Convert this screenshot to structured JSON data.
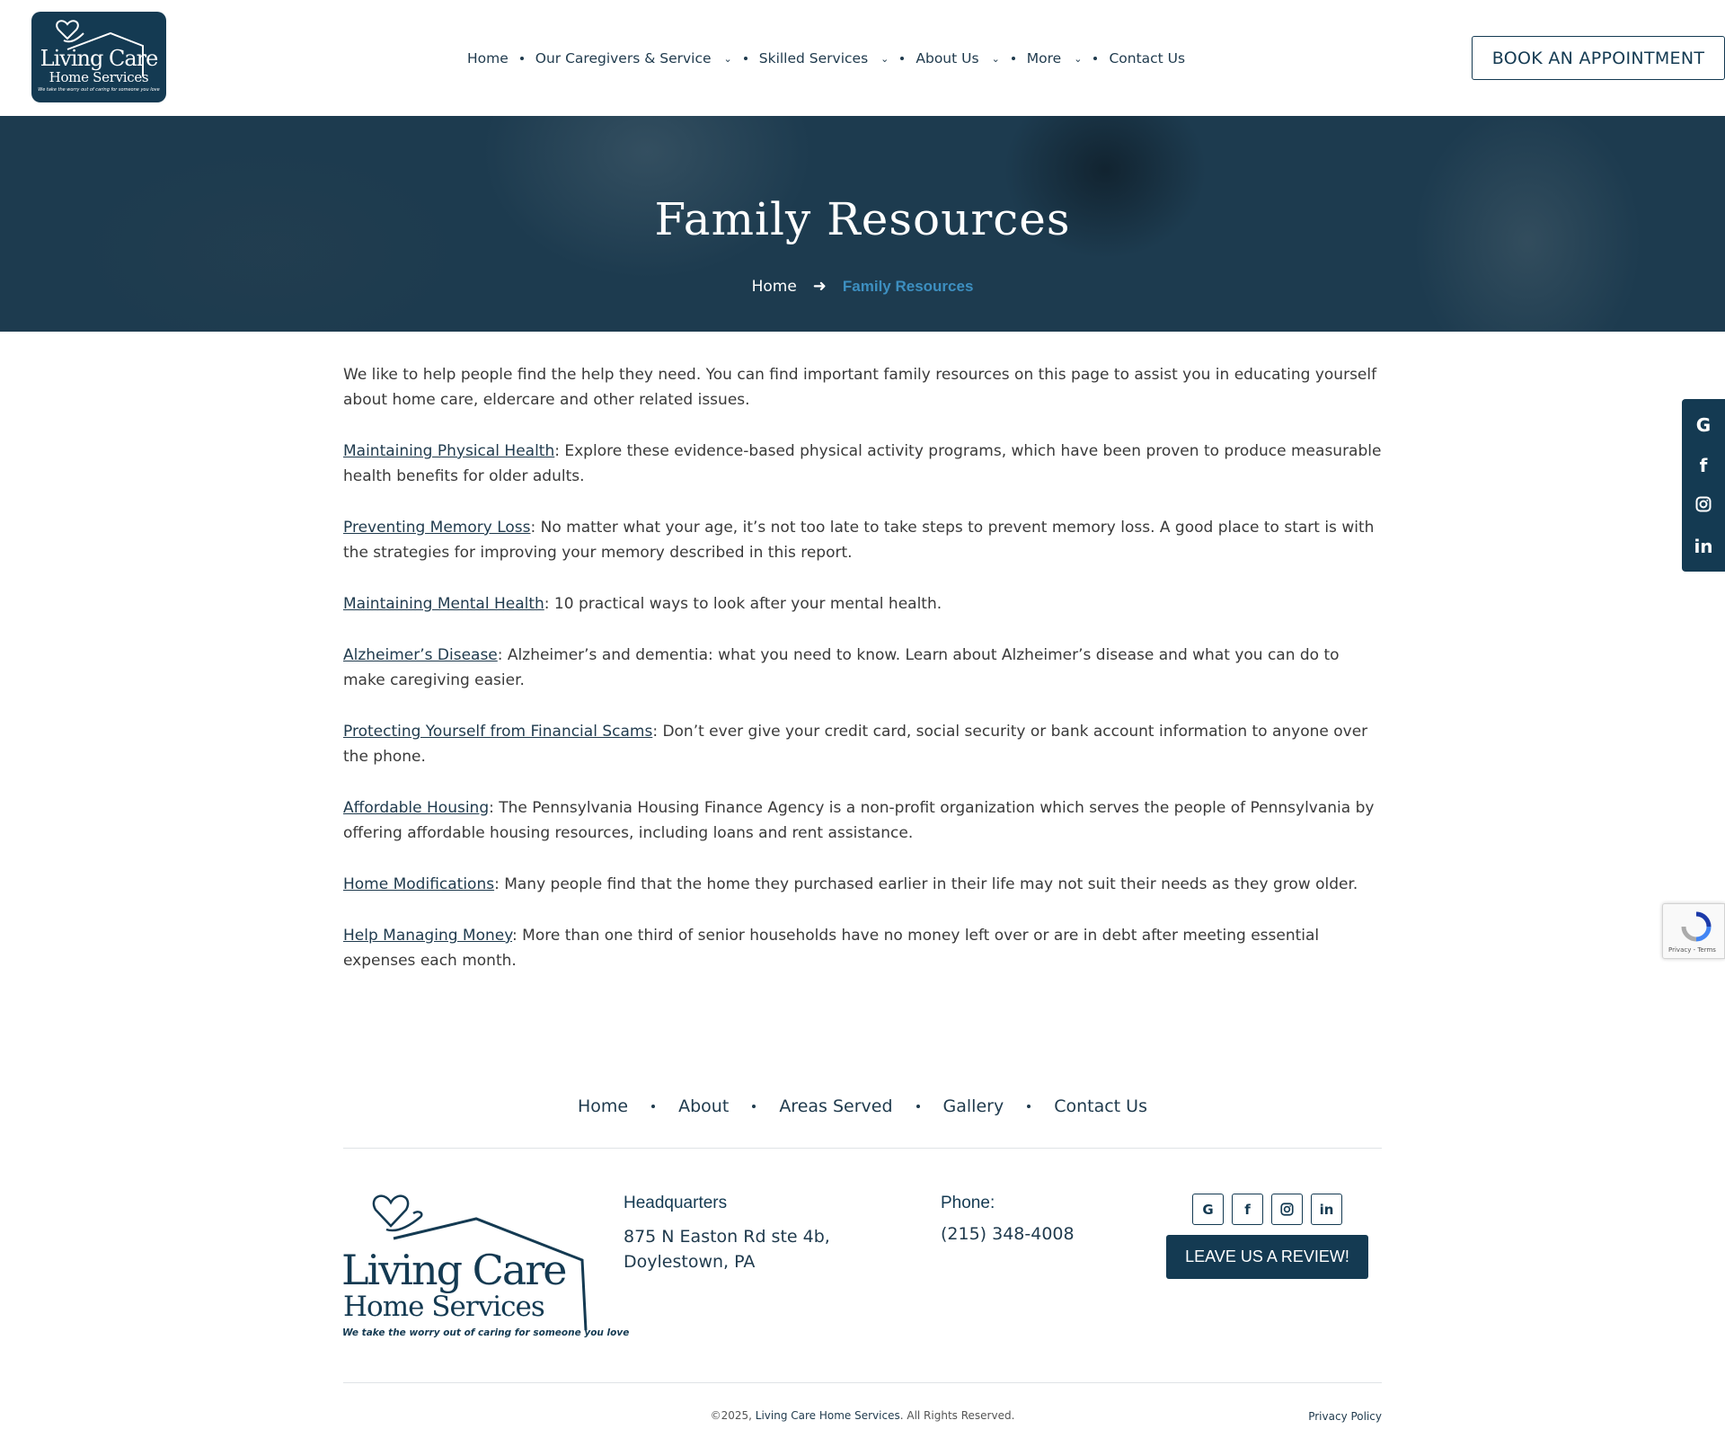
{
  "header": {
    "logo": {
      "line1": "Living Care",
      "line2": "Home Services",
      "tagline": "We take the worry out of caring for someone you love"
    },
    "nav": [
      {
        "label": "Home",
        "has_dropdown": false
      },
      {
        "label": "Our Caregivers & Service",
        "has_dropdown": true
      },
      {
        "label": "Skilled Services",
        "has_dropdown": true
      },
      {
        "label": "About Us",
        "has_dropdown": true
      },
      {
        "label": "More",
        "has_dropdown": true
      },
      {
        "label": "Contact Us",
        "has_dropdown": false
      }
    ],
    "cta_label": "BOOK AN APPOINTMENT"
  },
  "hero": {
    "title": "Family Resources",
    "breadcrumb": {
      "home": "Home",
      "current": "Family Resources"
    }
  },
  "content": {
    "intro": "We like to help people find the help they need. You can find important family resources on this page to assist you in educating yourself about home care, eldercare and other related issues.",
    "resources": [
      {
        "link": "Maintaining Physical Health",
        "text": ": Explore these evidence-based physical activity programs, which have been proven to produce measurable health benefits for older adults."
      },
      {
        "link": "Preventing Memory Loss",
        "text": ": No matter what your age, it’s not too late to take steps to prevent memory loss. A good place to start is with the strategies for improving your memory described in this report."
      },
      {
        "link": "Maintaining Mental Health",
        "text": ": 10 practical ways to look after your mental health."
      },
      {
        "link": "Alzheimer’s Disease",
        "text": ": Alzheimer’s and dementia: what you need to know. Learn about Alzheimer’s disease and what you can do to make caregiving easier."
      },
      {
        "link": "Protecting Yourself from Financial Scams",
        "text": ": Don’t ever give your credit card, social security or bank account information to anyone over the phone."
      },
      {
        "link": "Affordable Housing",
        "text": ": The Pennsylvania Housing Finance Agency is a non-profit organization which serves the people of Pennsylvania by offering affordable housing resources, including loans and rent assistance."
      },
      {
        "link": "Home Modifications",
        "text": ": Many people find that the home they purchased earlier in their life may not suit their needs as they grow older."
      },
      {
        "link": "Help Managing Money",
        "text": ": More than one third of senior households have no money left over or are in debt after meeting essential expenses each month."
      }
    ]
  },
  "side_social": [
    "google-icon",
    "facebook-icon",
    "instagram-icon",
    "linkedin-icon"
  ],
  "recaptcha": {
    "text": "Privacy - Terms"
  },
  "footer": {
    "nav": [
      "Home",
      "About",
      "Areas Served",
      "Gallery",
      "Contact Us"
    ],
    "hq_label": "Headquarters",
    "address_line1": "875 N Easton Rd ste 4b,",
    "address_line2": "Doylestown, PA",
    "phone_label": "Phone:",
    "phone": "(215) 348-4008",
    "social": [
      "google-icon",
      "facebook-icon",
      "instagram-icon",
      "linkedin-icon"
    ],
    "review_label": "LEAVE US A REVIEW!",
    "copyright_prefix": "©2025, ",
    "copyright_brand": "Living Care Home Services",
    "copyright_suffix": ". All Rights Reserved.",
    "privacy": "Privacy Policy"
  },
  "colors": {
    "brand": "#143a52",
    "accent": "#3d8fc0"
  }
}
